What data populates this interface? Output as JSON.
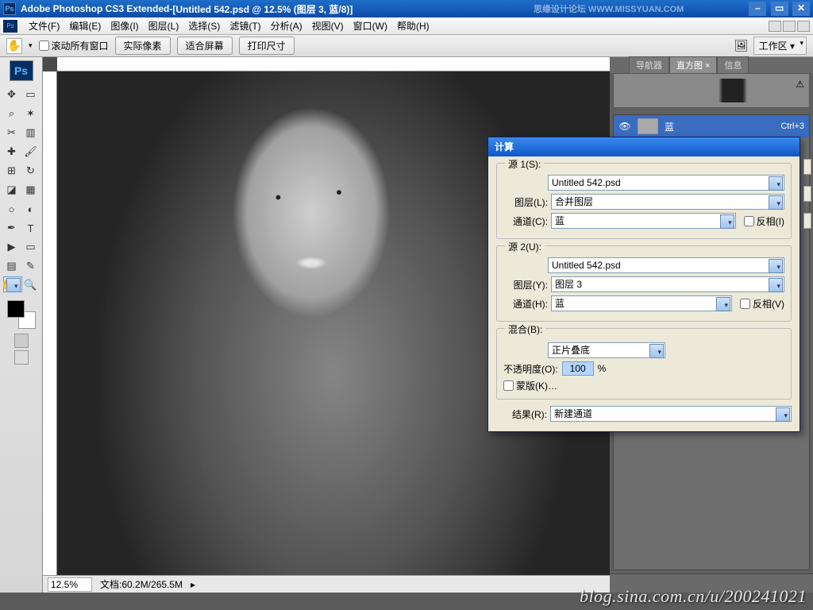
{
  "title": {
    "app": "Adobe Photoshop CS3 Extended",
    "sep": " - ",
    "doc": "[Untitled 542.psd @ 12.5% (图层 3, 蓝/8)]"
  },
  "watermark_top": "思缘设计论坛  WWW.MISSYUAN.COM",
  "menu": [
    "文件(F)",
    "编辑(E)",
    "图像(I)",
    "图层(L)",
    "选择(S)",
    "滤镜(T)",
    "分析(A)",
    "视图(V)",
    "窗口(W)",
    "帮助(H)"
  ],
  "optbar": {
    "scroll_all": "滚动所有窗口",
    "actual": "实际像素",
    "fit": "适合屏幕",
    "print": "打印尺寸",
    "workspace": "工作区 ▾"
  },
  "status": {
    "zoom": "12.5%",
    "docinfo": "文档:60.2M/265.5M"
  },
  "nav_tabs": [
    "导航器",
    "直方图 ×",
    "信息"
  ],
  "channel": {
    "name": "蓝",
    "shortcut": "Ctrl+3"
  },
  "dialog": {
    "title": "计算",
    "src1": "源 1(S):",
    "src1_v": "Untitled 542.psd",
    "layerL": "图层(L):",
    "layerL_v": "合并图层",
    "chanC": "通道(C):",
    "chanC_v": "蓝",
    "invI": "反相(I)",
    "src2": "源 2(U):",
    "src2_v": "Untitled 542.psd",
    "layerY": "图层(Y):",
    "layerY_v": "图层 3",
    "chanH": "通道(H):",
    "chanH_v": "蓝",
    "invV": "反相(V)",
    "blendB": "混合(B):",
    "blendB_v": "正片叠底",
    "opacO": "不透明度(O):",
    "opac_v": "100",
    "pct": "%",
    "maskK": "蒙版(K)…",
    "resultR": "结果(R):",
    "result_v": "新建通道"
  },
  "blog": "blog.sina.com.cn/u/200241021"
}
